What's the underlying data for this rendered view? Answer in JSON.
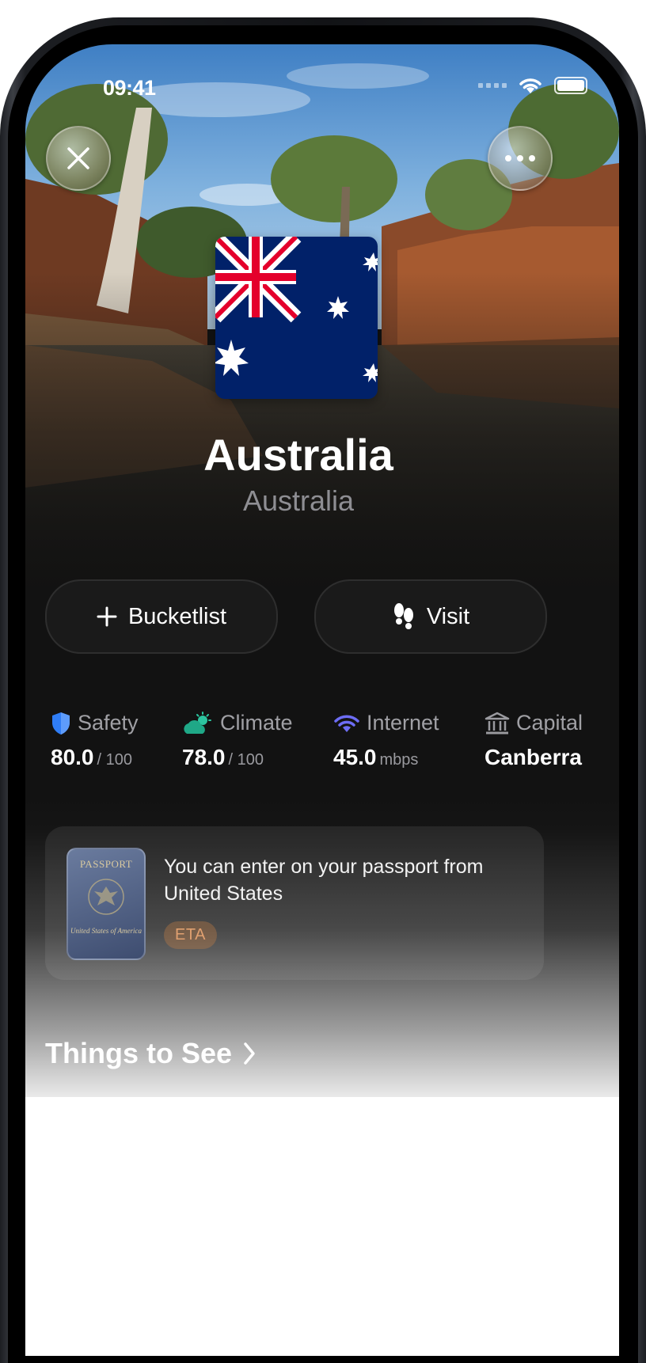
{
  "status_bar": {
    "time": "09:41"
  },
  "header": {
    "close_icon": "close-icon",
    "more_icon": "ellipsis-icon"
  },
  "country": {
    "name": "Australia",
    "native_name": "Australia",
    "flag": "australia-flag"
  },
  "actions": {
    "bucketlist_label": "Bucketlist",
    "visit_label": "Visit"
  },
  "stats": [
    {
      "label": "Safety",
      "value": "80.0",
      "unit": "/ 100",
      "icon": "shield-icon",
      "color": "#2f7df6"
    },
    {
      "label": "Climate",
      "value": "78.0",
      "unit": "/ 100",
      "icon": "partly-cloudy-icon",
      "color": "#2cc5a0"
    },
    {
      "label": "Internet",
      "value": "45.0",
      "unit": "mbps",
      "icon": "wifi-icon",
      "color": "#6d6df5"
    },
    {
      "label": "Capital",
      "value": "Canberra",
      "unit": "",
      "icon": "capitol-building-icon",
      "color": "#9a9a9f"
    }
  ],
  "passport": {
    "message": "You can enter on your passport from United States",
    "badge": "ETA",
    "cover_title": "PASSPORT",
    "cover_footer": "United States of America"
  },
  "sections": {
    "things_to_see": "Things to See"
  }
}
